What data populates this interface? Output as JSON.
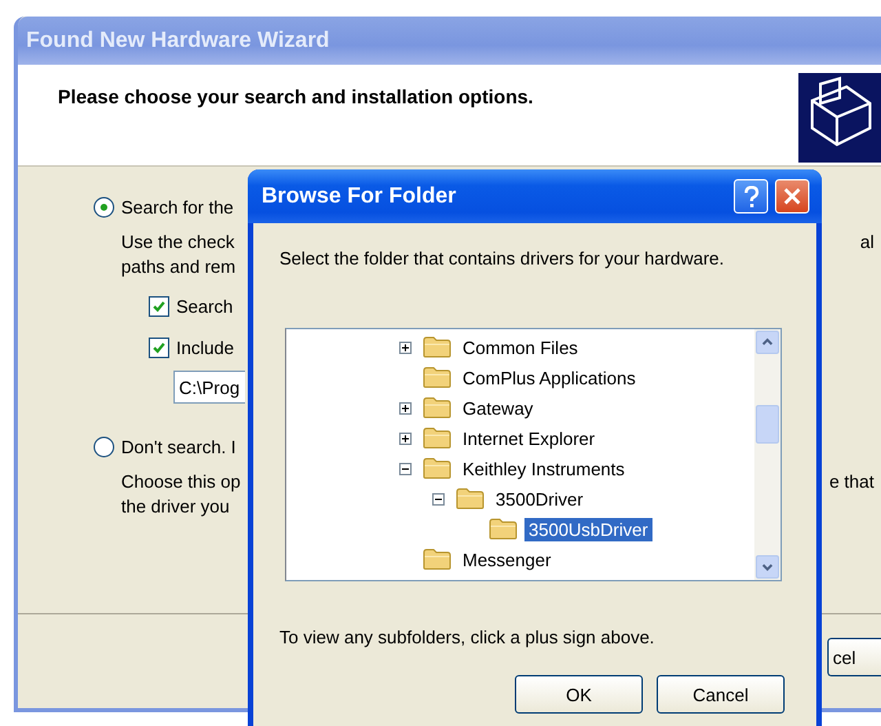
{
  "wizard": {
    "title": "Found New Hardware Wizard",
    "heading": "Please choose your search and installation options.",
    "options": [
      {
        "label": "Search for the",
        "selected": true,
        "description": [
          {
            "left": "Use the check",
            "right": "al"
          },
          {
            "left": "paths and rem"
          }
        ],
        "checkboxes": [
          {
            "label": "Search",
            "checked": true
          },
          {
            "label": "Include",
            "checked": true
          }
        ],
        "path": "C:\\Prog"
      },
      {
        "label": "Don't search. I",
        "selected": false,
        "description": [
          {
            "left": "Choose this op",
            "right": "e that"
          },
          {
            "left": "the driver you"
          }
        ]
      }
    ],
    "buttons": [
      "cel"
    ]
  },
  "dialog": {
    "title": "Browse For Folder",
    "instruction": "Select the folder that contains drivers for your hardware.",
    "tree": [
      {
        "label": "Common Files",
        "kind": "collapsed",
        "selected": false
      },
      {
        "label": "ComPlus Applications",
        "kind": "leaf",
        "selected": false
      },
      {
        "label": "Gateway",
        "kind": "collapsed",
        "selected": false
      },
      {
        "label": "Internet Explorer",
        "kind": "collapsed",
        "selected": false
      },
      {
        "label": "Keithley Instruments",
        "kind": "expanded",
        "selected": false,
        "children": [
          {
            "label": "3500Driver",
            "kind": "expanded",
            "selected": false,
            "children": [
              {
                "label": "3500UsbDriver",
                "kind": "leaf",
                "selected": true
              }
            ]
          }
        ]
      },
      {
        "label": "Messenger",
        "kind": "leaf",
        "selected": false
      }
    ],
    "hint": "To view any subfolders, click a plus sign above.",
    "buttons": [
      "OK",
      "Cancel"
    ]
  }
}
